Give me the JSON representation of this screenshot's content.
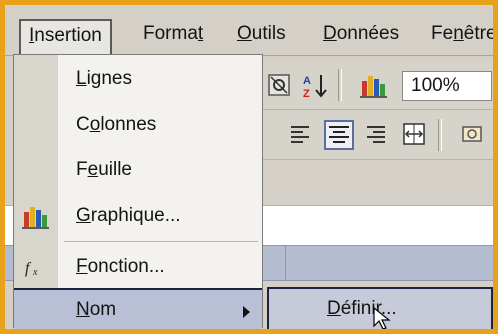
{
  "menubar": {
    "items": [
      {
        "prefix": "",
        "ul": "I",
        "suffix": "nsertion"
      },
      {
        "prefix": "Forma",
        "ul": "t",
        "suffix": ""
      },
      {
        "prefix": "",
        "ul": "O",
        "suffix": "utils"
      },
      {
        "prefix": "",
        "ul": "D",
        "suffix": "onnées"
      },
      {
        "prefix": "Fe",
        "ul": "n",
        "suffix": "être"
      }
    ]
  },
  "toolbar": {
    "zoom": "100%"
  },
  "dropdown": {
    "items": [
      {
        "prefix": "",
        "ul": "L",
        "suffix": "ignes"
      },
      {
        "prefix": "C",
        "ul": "o",
        "suffix": "lonnes"
      },
      {
        "prefix": "F",
        "ul": "e",
        "suffix": "uille"
      },
      {
        "prefix": "",
        "ul": "G",
        "suffix": "raphique..."
      },
      {
        "prefix": "",
        "ul": "F",
        "suffix": "onction..."
      },
      {
        "prefix": "",
        "ul": "N",
        "suffix": "om"
      }
    ]
  },
  "submenu": {
    "item": {
      "prefix": "",
      "ul": "D",
      "suffix": "éfinir..."
    }
  },
  "colors": {
    "frame_orange": "#e8a21a",
    "highlight": "#b9c0d6",
    "highlight_border": "#1c2340"
  },
  "icons": [
    "chart-icon",
    "function-icon",
    "submenu-arrow-icon",
    "mouse-pointer-icon"
  ]
}
